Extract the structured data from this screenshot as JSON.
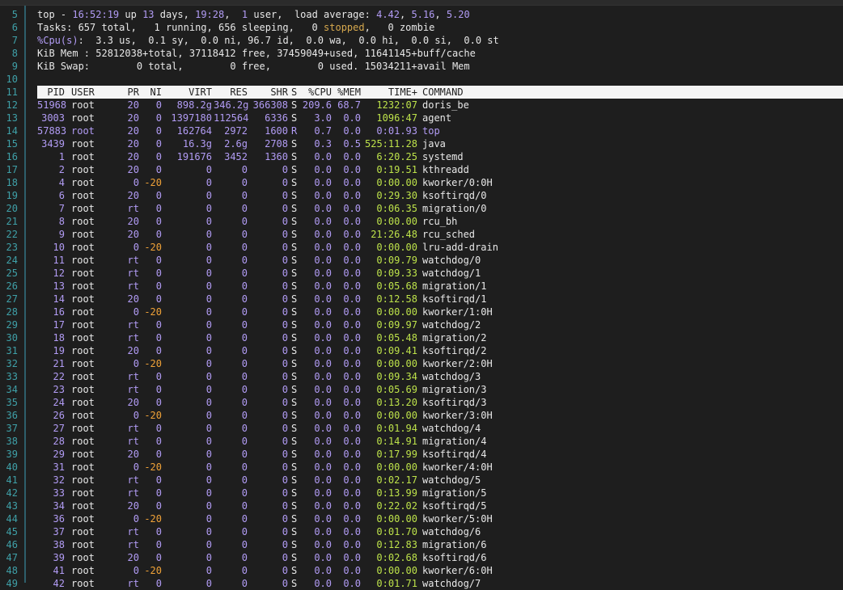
{
  "colors": {
    "background": "#1e1e1e",
    "line_number": "#3fa0a8",
    "number": "#b29cf5",
    "time": "#bde24a",
    "negative_nice": "#f0a238",
    "stopped": "#d7a94e",
    "header_bg": "#f4f4f4"
  },
  "summary": [
    {
      "line": "5",
      "segs": [
        {
          "t": "top - ",
          "c": "w"
        },
        {
          "t": "16:52:19",
          "c": "p"
        },
        {
          "t": " up ",
          "c": "w"
        },
        {
          "t": "13",
          "c": "p"
        },
        {
          "t": " days, ",
          "c": "w"
        },
        {
          "t": "19:28",
          "c": "p"
        },
        {
          "t": ",  ",
          "c": "w"
        },
        {
          "t": "1",
          "c": "p"
        },
        {
          "t": " user,  load average: ",
          "c": "w"
        },
        {
          "t": "4.42",
          "c": "p"
        },
        {
          "t": ", ",
          "c": "w"
        },
        {
          "t": "5.16",
          "c": "p"
        },
        {
          "t": ", ",
          "c": "w"
        },
        {
          "t": "5.20",
          "c": "p"
        }
      ]
    },
    {
      "line": "6",
      "segs": [
        {
          "t": "Tasks: 657 total,   1 running, 656 sleeping,   0 ",
          "c": "w"
        },
        {
          "t": "stopped",
          "c": "y"
        },
        {
          "t": ",   0 zombie",
          "c": "w"
        }
      ]
    },
    {
      "line": "7",
      "segs": [
        {
          "t": "%Cpu(s)",
          "c": "p"
        },
        {
          "t": ":  3.3 us,  0.1 sy,  0.0 ni, 96.7 id,  0.0 wa,  0.0 hi,  0.0 si,  0.0 st",
          "c": "w"
        }
      ]
    },
    {
      "line": "8",
      "segs": [
        {
          "t": "KiB Mem : 52812038+total, 37118412 free, 37459049+used, 11641145+buff/cache",
          "c": "w"
        }
      ]
    },
    {
      "line": "9",
      "segs": [
        {
          "t": "KiB Swap:        0 total,        0 free,        0 used. 15034211+avail Mem",
          "c": "w"
        }
      ]
    },
    {
      "line": "10",
      "segs": []
    }
  ],
  "table": {
    "line": "11",
    "headers": {
      "pid": "PID",
      "user": "USER",
      "pr": "PR",
      "ni": "NI",
      "virt": "VIRT",
      "res": "RES",
      "shr": "SHR",
      "s": "S",
      "cpu": "%CPU",
      "mem": "%MEM",
      "time": "TIME+",
      "cmd": "COMMAND"
    },
    "rows": [
      {
        "line": "12",
        "pid": "51968",
        "user": "root",
        "pr": "20",
        "ni": "0",
        "virt": "898.2g",
        "res": "346.2g",
        "shr": "366308",
        "s": "S",
        "cpu": "209.6",
        "mem": "68.7",
        "time": "1232:07",
        "cmd": "doris_be"
      },
      {
        "line": "13",
        "pid": "3003",
        "user": "root",
        "pr": "20",
        "ni": "0",
        "virt": "1397180",
        "res": "112564",
        "shr": "6336",
        "s": "S",
        "cpu": "3.0",
        "mem": "0.0",
        "time": "1096:47",
        "cmd": "agent"
      },
      {
        "line": "14",
        "pid": "57883",
        "user": "root",
        "pr": "20",
        "ni": "0",
        "virt": "162764",
        "res": "2972",
        "shr": "1600",
        "s": "R",
        "cpu": "0.7",
        "mem": "0.0",
        "time": "0:01.93",
        "cmd": "top",
        "hl": true
      },
      {
        "line": "15",
        "pid": "3439",
        "user": "root",
        "pr": "20",
        "ni": "0",
        "virt": "16.3g",
        "res": "2.6g",
        "shr": "2708",
        "s": "S",
        "cpu": "0.3",
        "mem": "0.5",
        "time": "525:11.28",
        "cmd": "java"
      },
      {
        "line": "16",
        "pid": "1",
        "user": "root",
        "pr": "20",
        "ni": "0",
        "virt": "191676",
        "res": "3452",
        "shr": "1360",
        "s": "S",
        "cpu": "0.0",
        "mem": "0.0",
        "time": "6:20.25",
        "cmd": "systemd"
      },
      {
        "line": "17",
        "pid": "2",
        "user": "root",
        "pr": "20",
        "ni": "0",
        "virt": "0",
        "res": "0",
        "shr": "0",
        "s": "S",
        "cpu": "0.0",
        "mem": "0.0",
        "time": "0:19.51",
        "cmd": "kthreadd"
      },
      {
        "line": "18",
        "pid": "4",
        "user": "root",
        "pr": "0",
        "ni": "-20",
        "virt": "0",
        "res": "0",
        "shr": "0",
        "s": "S",
        "cpu": "0.0",
        "mem": "0.0",
        "time": "0:00.00",
        "cmd": "kworker/0:0H"
      },
      {
        "line": "19",
        "pid": "6",
        "user": "root",
        "pr": "20",
        "ni": "0",
        "virt": "0",
        "res": "0",
        "shr": "0",
        "s": "S",
        "cpu": "0.0",
        "mem": "0.0",
        "time": "0:29.30",
        "cmd": "ksoftirqd/0"
      },
      {
        "line": "20",
        "pid": "7",
        "user": "root",
        "pr": "rt",
        "ni": "0",
        "virt": "0",
        "res": "0",
        "shr": "0",
        "s": "S",
        "cpu": "0.0",
        "mem": "0.0",
        "time": "0:06.35",
        "cmd": "migration/0"
      },
      {
        "line": "21",
        "pid": "8",
        "user": "root",
        "pr": "20",
        "ni": "0",
        "virt": "0",
        "res": "0",
        "shr": "0",
        "s": "S",
        "cpu": "0.0",
        "mem": "0.0",
        "time": "0:00.00",
        "cmd": "rcu_bh"
      },
      {
        "line": "22",
        "pid": "9",
        "user": "root",
        "pr": "20",
        "ni": "0",
        "virt": "0",
        "res": "0",
        "shr": "0",
        "s": "S",
        "cpu": "0.0",
        "mem": "0.0",
        "time": "21:26.48",
        "cmd": "rcu_sched"
      },
      {
        "line": "23",
        "pid": "10",
        "user": "root",
        "pr": "0",
        "ni": "-20",
        "virt": "0",
        "res": "0",
        "shr": "0",
        "s": "S",
        "cpu": "0.0",
        "mem": "0.0",
        "time": "0:00.00",
        "cmd": "lru-add-drain"
      },
      {
        "line": "24",
        "pid": "11",
        "user": "root",
        "pr": "rt",
        "ni": "0",
        "virt": "0",
        "res": "0",
        "shr": "0",
        "s": "S",
        "cpu": "0.0",
        "mem": "0.0",
        "time": "0:09.79",
        "cmd": "watchdog/0"
      },
      {
        "line": "25",
        "pid": "12",
        "user": "root",
        "pr": "rt",
        "ni": "0",
        "virt": "0",
        "res": "0",
        "shr": "0",
        "s": "S",
        "cpu": "0.0",
        "mem": "0.0",
        "time": "0:09.33",
        "cmd": "watchdog/1"
      },
      {
        "line": "26",
        "pid": "13",
        "user": "root",
        "pr": "rt",
        "ni": "0",
        "virt": "0",
        "res": "0",
        "shr": "0",
        "s": "S",
        "cpu": "0.0",
        "mem": "0.0",
        "time": "0:05.68",
        "cmd": "migration/1"
      },
      {
        "line": "27",
        "pid": "14",
        "user": "root",
        "pr": "20",
        "ni": "0",
        "virt": "0",
        "res": "0",
        "shr": "0",
        "s": "S",
        "cpu": "0.0",
        "mem": "0.0",
        "time": "0:12.58",
        "cmd": "ksoftirqd/1"
      },
      {
        "line": "28",
        "pid": "16",
        "user": "root",
        "pr": "0",
        "ni": "-20",
        "virt": "0",
        "res": "0",
        "shr": "0",
        "s": "S",
        "cpu": "0.0",
        "mem": "0.0",
        "time": "0:00.00",
        "cmd": "kworker/1:0H"
      },
      {
        "line": "29",
        "pid": "17",
        "user": "root",
        "pr": "rt",
        "ni": "0",
        "virt": "0",
        "res": "0",
        "shr": "0",
        "s": "S",
        "cpu": "0.0",
        "mem": "0.0",
        "time": "0:09.97",
        "cmd": "watchdog/2"
      },
      {
        "line": "30",
        "pid": "18",
        "user": "root",
        "pr": "rt",
        "ni": "0",
        "virt": "0",
        "res": "0",
        "shr": "0",
        "s": "S",
        "cpu": "0.0",
        "mem": "0.0",
        "time": "0:05.48",
        "cmd": "migration/2"
      },
      {
        "line": "31",
        "pid": "19",
        "user": "root",
        "pr": "20",
        "ni": "0",
        "virt": "0",
        "res": "0",
        "shr": "0",
        "s": "S",
        "cpu": "0.0",
        "mem": "0.0",
        "time": "0:09.41",
        "cmd": "ksoftirqd/2"
      },
      {
        "line": "32",
        "pid": "21",
        "user": "root",
        "pr": "0",
        "ni": "-20",
        "virt": "0",
        "res": "0",
        "shr": "0",
        "s": "S",
        "cpu": "0.0",
        "mem": "0.0",
        "time": "0:00.00",
        "cmd": "kworker/2:0H"
      },
      {
        "line": "33",
        "pid": "22",
        "user": "root",
        "pr": "rt",
        "ni": "0",
        "virt": "0",
        "res": "0",
        "shr": "0",
        "s": "S",
        "cpu": "0.0",
        "mem": "0.0",
        "time": "0:09.34",
        "cmd": "watchdog/3"
      },
      {
        "line": "34",
        "pid": "23",
        "user": "root",
        "pr": "rt",
        "ni": "0",
        "virt": "0",
        "res": "0",
        "shr": "0",
        "s": "S",
        "cpu": "0.0",
        "mem": "0.0",
        "time": "0:05.69",
        "cmd": "migration/3"
      },
      {
        "line": "35",
        "pid": "24",
        "user": "root",
        "pr": "20",
        "ni": "0",
        "virt": "0",
        "res": "0",
        "shr": "0",
        "s": "S",
        "cpu": "0.0",
        "mem": "0.0",
        "time": "0:13.20",
        "cmd": "ksoftirqd/3"
      },
      {
        "line": "36",
        "pid": "26",
        "user": "root",
        "pr": "0",
        "ni": "-20",
        "virt": "0",
        "res": "0",
        "shr": "0",
        "s": "S",
        "cpu": "0.0",
        "mem": "0.0",
        "time": "0:00.00",
        "cmd": "kworker/3:0H"
      },
      {
        "line": "37",
        "pid": "27",
        "user": "root",
        "pr": "rt",
        "ni": "0",
        "virt": "0",
        "res": "0",
        "shr": "0",
        "s": "S",
        "cpu": "0.0",
        "mem": "0.0",
        "time": "0:01.94",
        "cmd": "watchdog/4"
      },
      {
        "line": "38",
        "pid": "28",
        "user": "root",
        "pr": "rt",
        "ni": "0",
        "virt": "0",
        "res": "0",
        "shr": "0",
        "s": "S",
        "cpu": "0.0",
        "mem": "0.0",
        "time": "0:14.91",
        "cmd": "migration/4"
      },
      {
        "line": "39",
        "pid": "29",
        "user": "root",
        "pr": "20",
        "ni": "0",
        "virt": "0",
        "res": "0",
        "shr": "0",
        "s": "S",
        "cpu": "0.0",
        "mem": "0.0",
        "time": "0:17.99",
        "cmd": "ksoftirqd/4"
      },
      {
        "line": "40",
        "pid": "31",
        "user": "root",
        "pr": "0",
        "ni": "-20",
        "virt": "0",
        "res": "0",
        "shr": "0",
        "s": "S",
        "cpu": "0.0",
        "mem": "0.0",
        "time": "0:00.00",
        "cmd": "kworker/4:0H"
      },
      {
        "line": "41",
        "pid": "32",
        "user": "root",
        "pr": "rt",
        "ni": "0",
        "virt": "0",
        "res": "0",
        "shr": "0",
        "s": "S",
        "cpu": "0.0",
        "mem": "0.0",
        "time": "0:02.17",
        "cmd": "watchdog/5"
      },
      {
        "line": "42",
        "pid": "33",
        "user": "root",
        "pr": "rt",
        "ni": "0",
        "virt": "0",
        "res": "0",
        "shr": "0",
        "s": "S",
        "cpu": "0.0",
        "mem": "0.0",
        "time": "0:13.99",
        "cmd": "migration/5"
      },
      {
        "line": "43",
        "pid": "34",
        "user": "root",
        "pr": "20",
        "ni": "0",
        "virt": "0",
        "res": "0",
        "shr": "0",
        "s": "S",
        "cpu": "0.0",
        "mem": "0.0",
        "time": "0:22.02",
        "cmd": "ksoftirqd/5"
      },
      {
        "line": "44",
        "pid": "36",
        "user": "root",
        "pr": "0",
        "ni": "-20",
        "virt": "0",
        "res": "0",
        "shr": "0",
        "s": "S",
        "cpu": "0.0",
        "mem": "0.0",
        "time": "0:00.00",
        "cmd": "kworker/5:0H"
      },
      {
        "line": "45",
        "pid": "37",
        "user": "root",
        "pr": "rt",
        "ni": "0",
        "virt": "0",
        "res": "0",
        "shr": "0",
        "s": "S",
        "cpu": "0.0",
        "mem": "0.0",
        "time": "0:01.70",
        "cmd": "watchdog/6"
      },
      {
        "line": "46",
        "pid": "38",
        "user": "root",
        "pr": "rt",
        "ni": "0",
        "virt": "0",
        "res": "0",
        "shr": "0",
        "s": "S",
        "cpu": "0.0",
        "mem": "0.0",
        "time": "0:12.83",
        "cmd": "migration/6"
      },
      {
        "line": "47",
        "pid": "39",
        "user": "root",
        "pr": "20",
        "ni": "0",
        "virt": "0",
        "res": "0",
        "shr": "0",
        "s": "S",
        "cpu": "0.0",
        "mem": "0.0",
        "time": "0:02.68",
        "cmd": "ksoftirqd/6"
      },
      {
        "line": "48",
        "pid": "41",
        "user": "root",
        "pr": "0",
        "ni": "-20",
        "virt": "0",
        "res": "0",
        "shr": "0",
        "s": "S",
        "cpu": "0.0",
        "mem": "0.0",
        "time": "0:00.00",
        "cmd": "kworker/6:0H"
      },
      {
        "line": "49",
        "pid": "42",
        "user": "root",
        "pr": "rt",
        "ni": "0",
        "virt": "0",
        "res": "0",
        "shr": "0",
        "s": "S",
        "cpu": "0.0",
        "mem": "0.0",
        "time": "0:01.71",
        "cmd": "watchdog/7"
      }
    ]
  }
}
